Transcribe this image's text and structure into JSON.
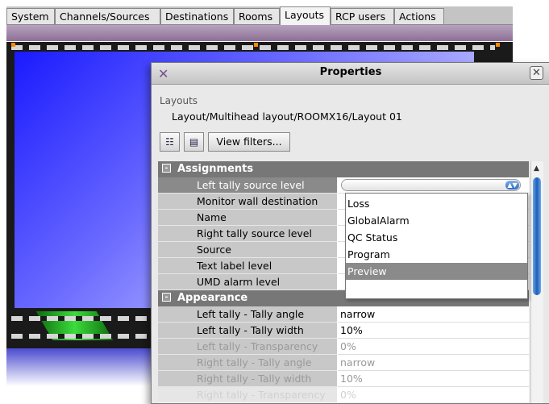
{
  "tabs": [
    {
      "label": "System"
    },
    {
      "label": "Channels/Sources"
    },
    {
      "label": "Destinations"
    },
    {
      "label": "Rooms"
    },
    {
      "label": "Layouts",
      "active": true
    },
    {
      "label": "RCP users"
    },
    {
      "label": "Actions"
    }
  ],
  "dialog": {
    "title": "Properties",
    "path_label": "Layouts",
    "path_value": "Layout/Multihead layout/ROOMX16/Layout 01",
    "view_filters_label": "View filters...",
    "categorized_icon": "categorized-view-icon",
    "list_icon": "list-view-icon",
    "close_icon": "close-icon"
  },
  "grid": {
    "categories": [
      {
        "label": "Assignments",
        "toggle": "-"
      },
      {
        "label": "Appearance",
        "toggle": "-"
      }
    ],
    "assignments": [
      {
        "name": "Left tally source level",
        "value": ""
      },
      {
        "name": "Monitor wall destination",
        "value": ""
      },
      {
        "name": "Name",
        "value": ""
      },
      {
        "name": "Right tally source level",
        "value": ""
      },
      {
        "name": "Source",
        "value": ""
      },
      {
        "name": "Text label level",
        "value": ""
      },
      {
        "name": "UMD alarm level",
        "value": ""
      }
    ],
    "appearance": [
      {
        "name": "Left tally - Tally angle",
        "value": "narrow"
      },
      {
        "name": "Left tally - Tally width",
        "value": "10%"
      },
      {
        "name": "Left tally - Transparency",
        "value": "0%"
      },
      {
        "name": "Right tally - Tally angle",
        "value": "narrow"
      },
      {
        "name": "Right tally - Tally width",
        "value": "10%"
      },
      {
        "name": "Right tally - Transparency",
        "value": "0%"
      }
    ]
  },
  "dropdown": {
    "options": [
      "Loss",
      "GlobalAlarm",
      "QC Status",
      "Program",
      "Preview"
    ],
    "highlighted": "Preview"
  },
  "colors": {
    "accent_purple": "#8c6f94",
    "selection_gray": "#8a8a8a",
    "scroll_thumb_blue": "#1d5fb8",
    "tally_green": "#3cdc3c"
  }
}
